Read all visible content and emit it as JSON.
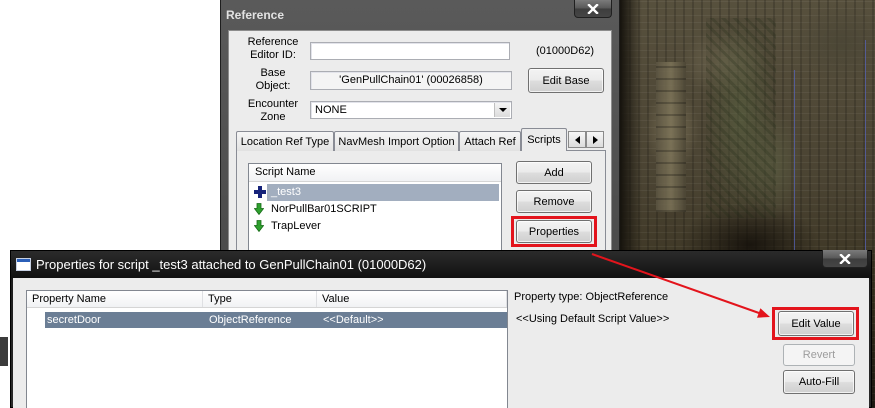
{
  "reference_window": {
    "title": "Reference",
    "close_icon": "close-icon",
    "editor_id": {
      "label": "Reference\nEditor ID:",
      "value": "",
      "form_id": "(01000D62)"
    },
    "base_object": {
      "label": "Base\nObject:",
      "value": "'GenPullChain01' (00026858)",
      "button": "Edit Base"
    },
    "encounter_zone": {
      "label": "Encounter\nZone",
      "value": "NONE"
    },
    "tabs": [
      {
        "label": "Location Ref Type",
        "selected": false
      },
      {
        "label": "NavMesh Import Option",
        "selected": false
      },
      {
        "label": "Attach Ref",
        "selected": false
      },
      {
        "label": "Scripts",
        "selected": true
      }
    ],
    "tab_scroll_icons": [
      "arrow-left-icon",
      "arrow-right-icon"
    ],
    "scripts": {
      "column": "Script Name",
      "items": [
        {
          "name": "_test3",
          "icon": "blue-plus-icon",
          "selected": true
        },
        {
          "name": "NorPullBar01SCRIPT",
          "icon": "green-down-arrow-icon",
          "selected": false
        },
        {
          "name": "TrapLever",
          "icon": "green-down-arrow-icon",
          "selected": false
        }
      ],
      "buttons": {
        "add": "Add",
        "remove": "Remove",
        "properties": "Properties"
      }
    }
  },
  "properties_dialog": {
    "title": "Properties for script _test3 attached to GenPullChain01 (01000D62)",
    "icon": "window-icon",
    "close_icon": "close-icon",
    "columns": {
      "name": "Property Name",
      "type": "Type",
      "value": "Value"
    },
    "rows": [
      {
        "name": "secretDoor",
        "type": "ObjectReference",
        "value": "<<Default>>",
        "selected": true
      }
    ],
    "property_type": "Property type: ObjectReference",
    "current_value": "<<Using Default Script Value>>",
    "buttons": {
      "edit_value": "Edit Value",
      "revert": "Revert",
      "auto_fill": "Auto-Fill"
    },
    "revert_disabled": true
  },
  "colors": {
    "annotation_red": "#e3141c",
    "reference_selection": "#a2aebf",
    "properties_selection": "#6b7e95",
    "window_face": "#ececec"
  }
}
